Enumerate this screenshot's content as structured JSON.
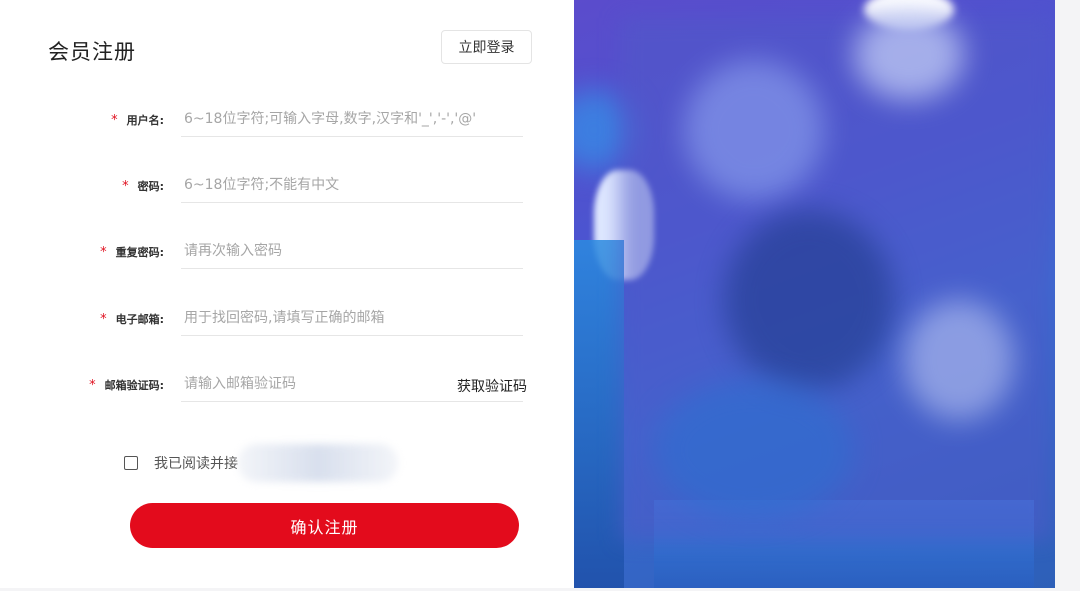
{
  "form": {
    "title": "会员注册",
    "login_button": "立即登录",
    "required_mark": "*",
    "fields": [
      {
        "label": "用户名:",
        "placeholder": "6~18位字符;可输入字母,数字,汉字和'_','-','@'"
      },
      {
        "label": "密码:",
        "placeholder": "6~18位字符;不能有中文"
      },
      {
        "label": "重复密码:",
        "placeholder": "请再次输入密码"
      },
      {
        "label": "电子邮箱:",
        "placeholder": "用于找回密码,请填写正确的邮箱"
      },
      {
        "label": "邮箱验证码:",
        "placeholder": "请输入邮箱验证码"
      }
    ],
    "get_code_button": "获取验证码",
    "agree_text": "我已阅读并接",
    "submit_button": "确认注册"
  },
  "colors": {
    "accent": "#e30b1c",
    "required": "#e0101f",
    "art_background": "#4a55d0"
  }
}
